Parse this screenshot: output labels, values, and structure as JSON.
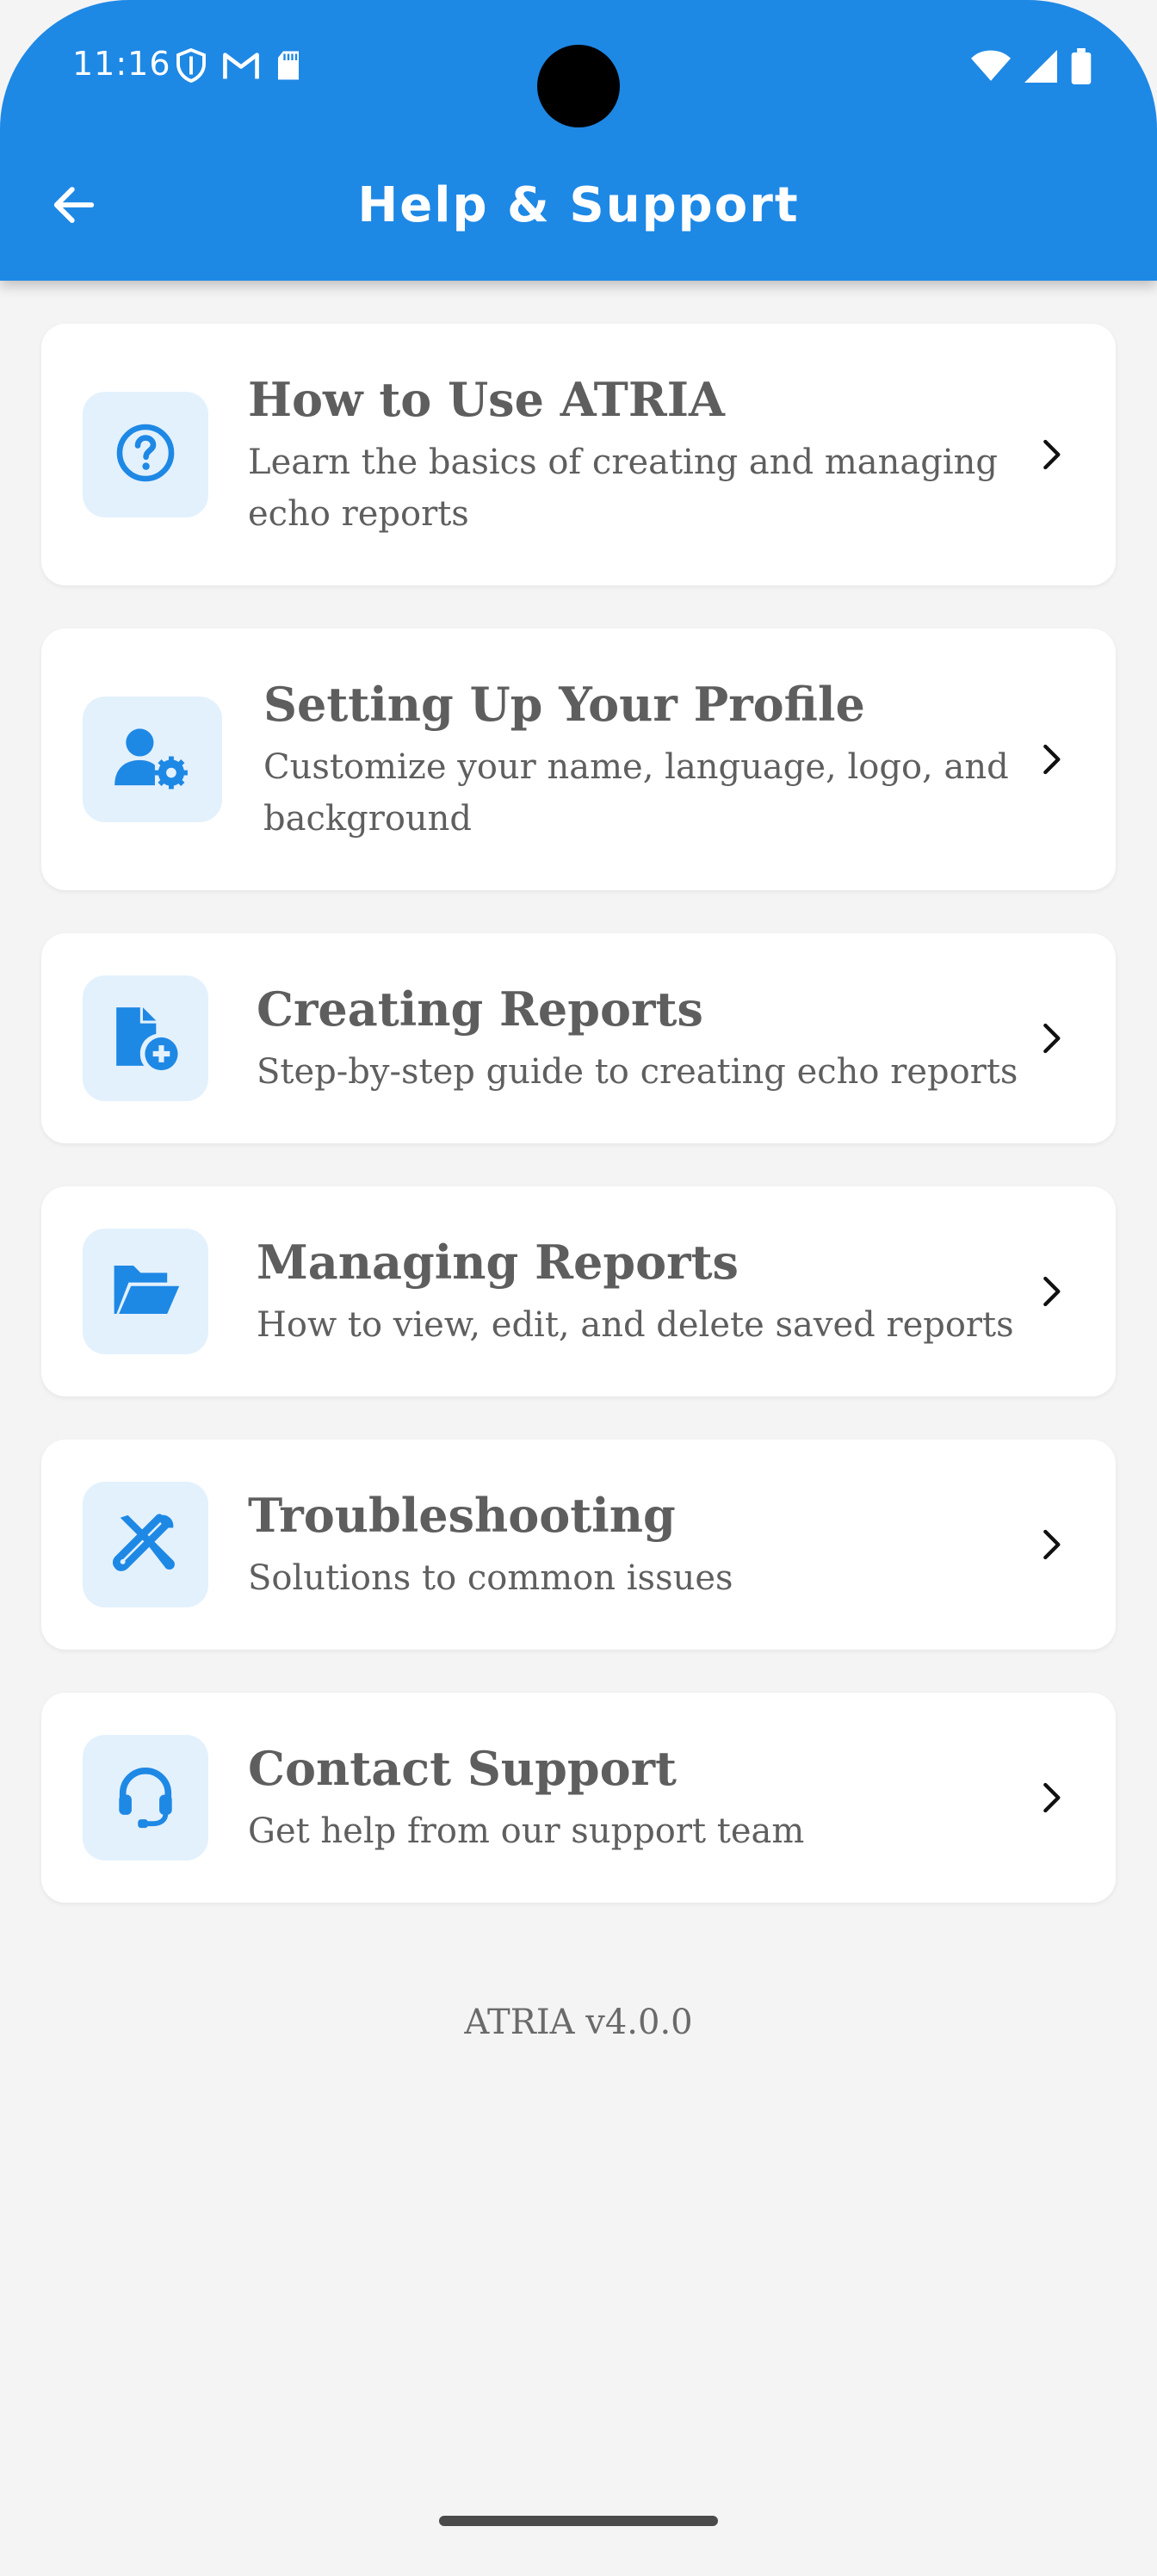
{
  "status_bar": {
    "time": "11:16",
    "left_icons": [
      "shield-icon",
      "gmail-icon",
      "sd-card-icon"
    ],
    "right_icons": [
      "wifi-icon",
      "cellular-signal-icon",
      "battery-icon"
    ]
  },
  "app_bar": {
    "title": "Help & Support",
    "back_icon": "arrow-back-icon",
    "background_color": "#1e88e5"
  },
  "items": [
    {
      "title": "How to Use ATRIA",
      "description": "Learn the basics of creating and managing echo reports",
      "icon": "help-circle-icon"
    },
    {
      "title": "Setting Up Your Profile",
      "description": "Customize your name, language, logo, and background",
      "icon": "user-settings-icon"
    },
    {
      "title": "Creating Reports",
      "description": "Step-by-step guide to creating echo reports",
      "icon": "file-add-icon"
    },
    {
      "title": "Managing Reports",
      "description": "How to view, edit, and delete saved reports",
      "icon": "folder-open-icon"
    },
    {
      "title": "Troubleshooting",
      "description": "Solutions to common issues",
      "icon": "tools-icon"
    },
    {
      "title": "Contact Support",
      "description": "Get help from our support team",
      "icon": "headset-icon"
    }
  ],
  "version": "ATRIA v4.0.0",
  "colors": {
    "accent": "#1e88e5",
    "icon_background": "#e3f1fd",
    "page_background": "#f4f4f5"
  }
}
